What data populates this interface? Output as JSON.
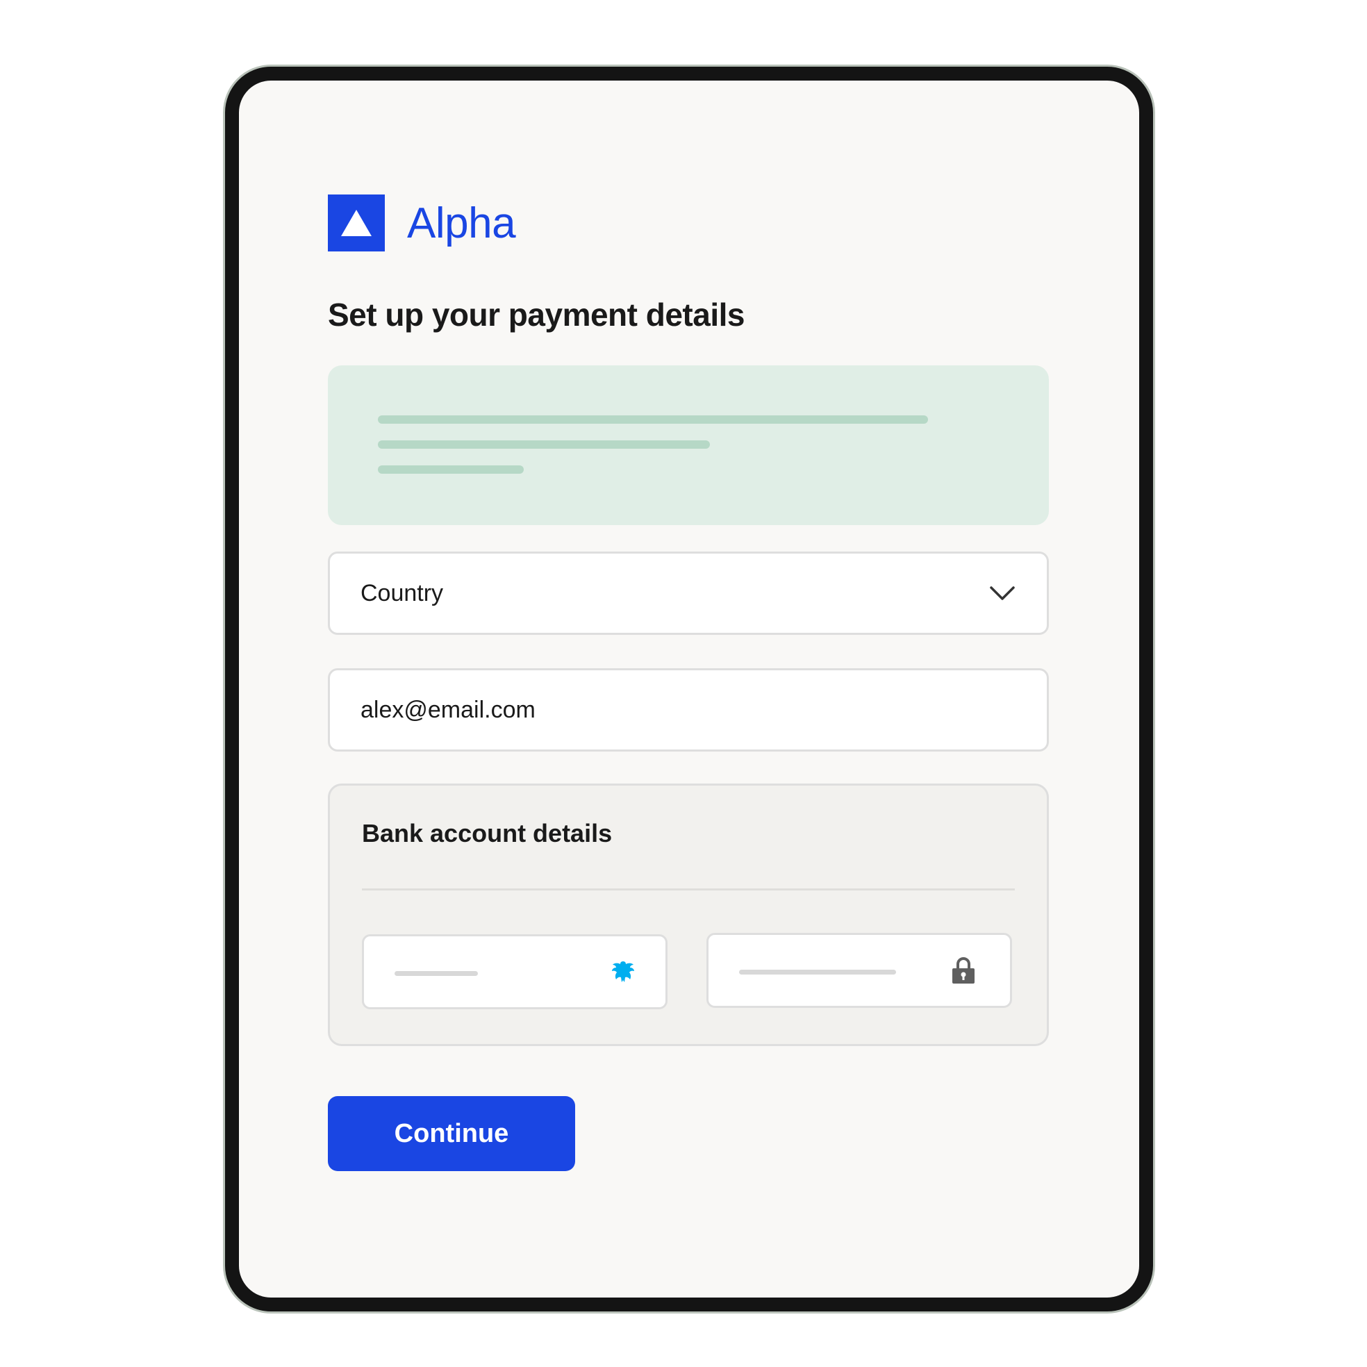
{
  "brand": {
    "name": "Alpha",
    "logo_icon": "triangle-icon",
    "color": "#1a46e3"
  },
  "page": {
    "title": "Set up your payment details"
  },
  "info_banner": {
    "background": "#e0eee6",
    "line_color": "#b6d8c6"
  },
  "form": {
    "country": {
      "label": "Country",
      "icon": "chevron-down-icon"
    },
    "email": {
      "value": "alex@email.com"
    },
    "bank": {
      "title": "Bank account details",
      "sort_code_icon": "bank-eagle-icon",
      "account_number_icon": "lock-icon"
    }
  },
  "actions": {
    "continue_label": "Continue"
  },
  "colors": {
    "accent": "#1a46e3",
    "bank_icon": "#00aeef",
    "lock_icon": "#5f5f5f"
  }
}
